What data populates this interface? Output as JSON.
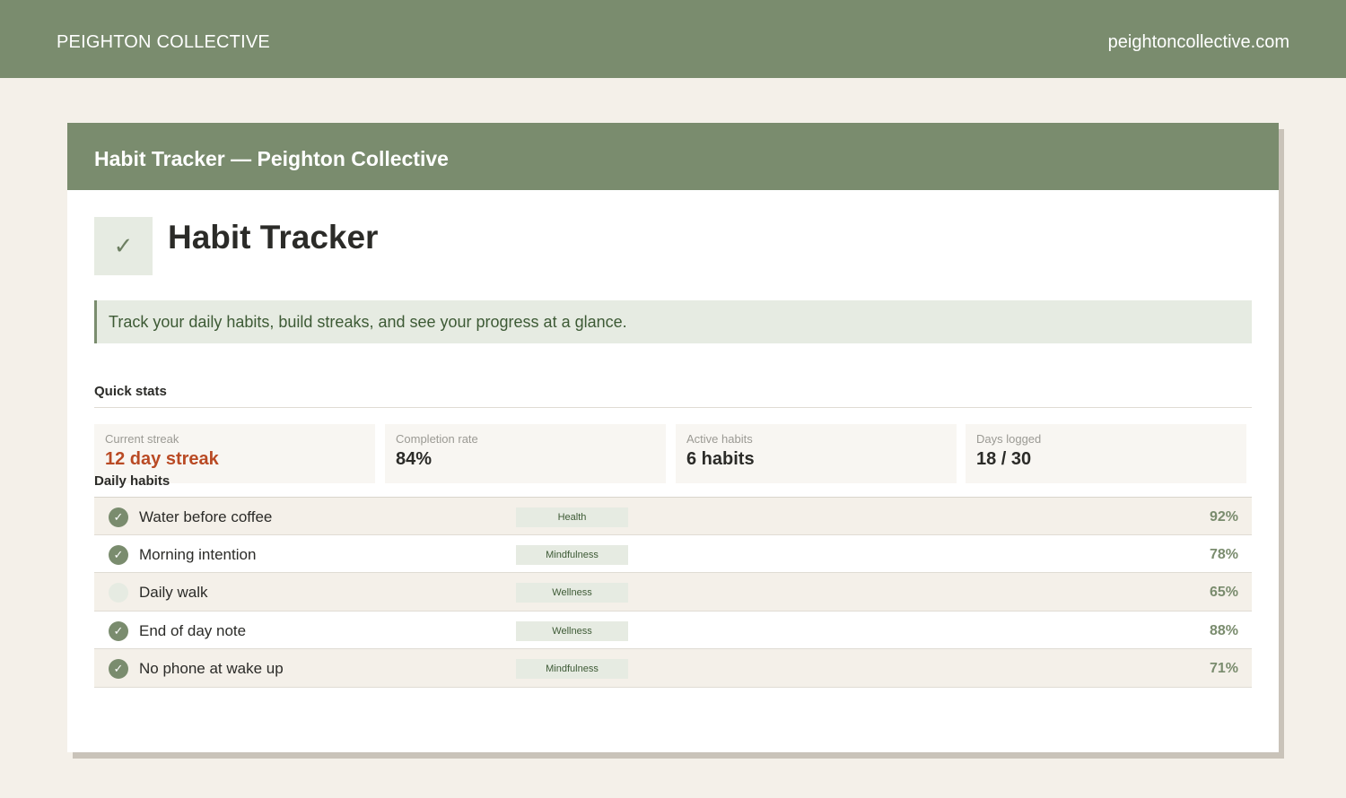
{
  "header": {
    "brand": "PEIGHTON COLLECTIVE",
    "site": "peightoncollective.com"
  },
  "card": {
    "header_title": "Habit Tracker — Peighton Collective",
    "icon": "check-icon",
    "icon_glyph": "✓",
    "title": "Habit Tracker",
    "callout": "Track your daily habits, build streaks, and see your progress at a glance."
  },
  "quick_stats": {
    "label": "Quick stats",
    "items": [
      {
        "label": "Current streak",
        "value": "12 day streak"
      },
      {
        "label": "Completion rate",
        "value": "84%"
      },
      {
        "label": "Active habits",
        "value": "6 habits"
      },
      {
        "label": "Days logged",
        "value": "18 / 30"
      }
    ]
  },
  "daily_habits": {
    "label": "Daily habits",
    "items": [
      {
        "name": "Water before coffee",
        "tag": "Health",
        "pct": "92%",
        "done": true,
        "check": "✓"
      },
      {
        "name": "Morning intention",
        "tag": "Mindfulness",
        "pct": "78%",
        "done": true,
        "check": "✓"
      },
      {
        "name": "Daily walk",
        "tag": "Wellness",
        "pct": "65%",
        "done": false,
        "check": ""
      },
      {
        "name": "End of day note",
        "tag": "Wellness",
        "pct": "88%",
        "done": true,
        "check": "✓"
      },
      {
        "name": "No phone at wake up",
        "tag": "Mindfulness",
        "pct": "71%",
        "done": true,
        "check": "✓"
      }
    ]
  },
  "colors": {
    "brand_green": "#7a8c6e",
    "accent_orange": "#b94a24",
    "page_bg": "#f4f0e9"
  }
}
